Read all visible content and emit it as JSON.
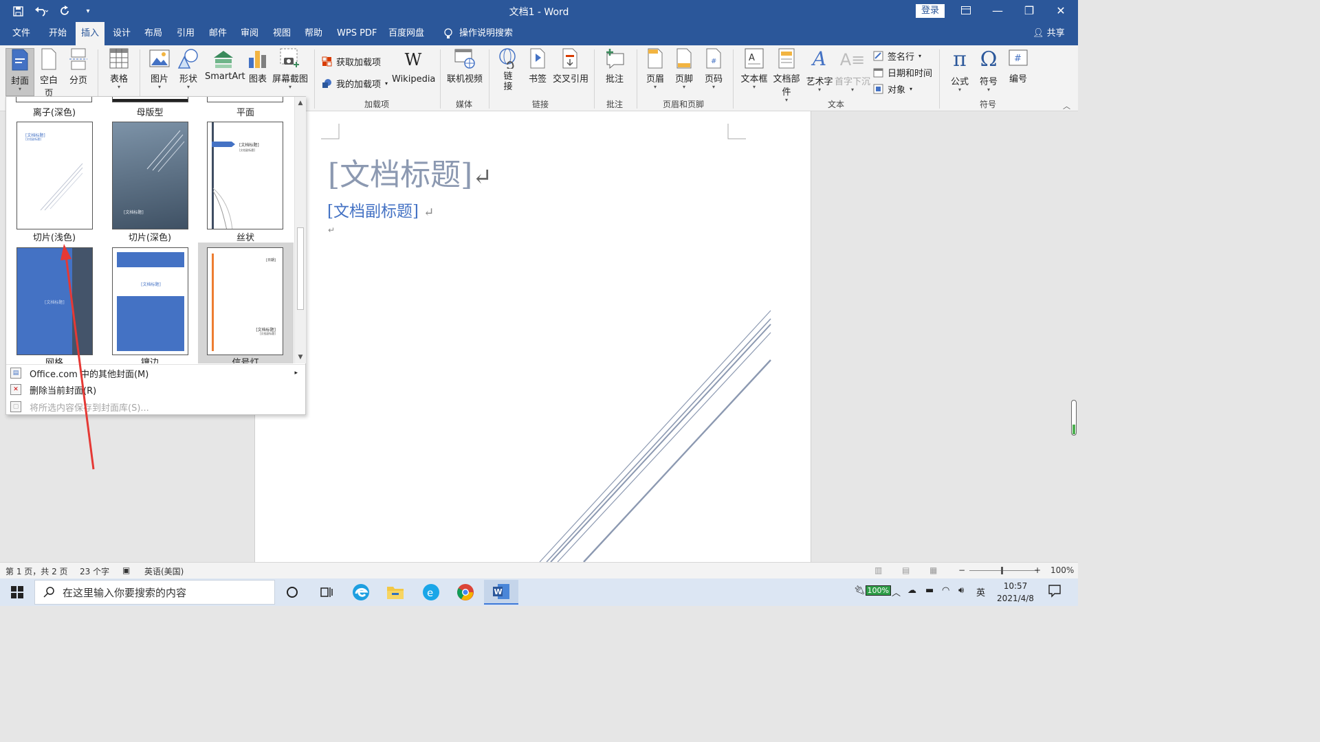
{
  "window": {
    "title": "文档1  -  Word",
    "login": "登录",
    "share": "共享"
  },
  "tabs": [
    "文件",
    "开始",
    "插入",
    "设计",
    "布局",
    "引用",
    "邮件",
    "审阅",
    "视图",
    "帮助",
    "WPS PDF",
    "百度网盘"
  ],
  "active_tab": "插入",
  "tell_me": "操作说明搜索",
  "ribbon": {
    "pages": {
      "cover": "封面",
      "blank": "空白页",
      "break": "分页"
    },
    "table": "表格",
    "illustrations": {
      "picture": "图片",
      "shapes": "形状",
      "smartart": "SmartArt",
      "chart": "图表",
      "screenshot": "屏幕截图"
    },
    "addins": {
      "get": "获取加载项",
      "mine": "我的加载项",
      "wikipedia": "Wikipedia",
      "group": "加载项"
    },
    "media": {
      "video": "联机视频",
      "group": "媒体"
    },
    "links": {
      "link": "链接",
      "bookmark": "书签",
      "crossref": "交叉引用",
      "group": "链接"
    },
    "comments": {
      "comment": "批注",
      "group": "批注"
    },
    "header_footer": {
      "header": "页眉",
      "footer": "页脚",
      "page_number": "页码",
      "group": "页眉和页脚"
    },
    "text": {
      "textbox": "文本框",
      "quickparts": "文档部件",
      "wordart": "艺术字",
      "dropcap": "首字下沉",
      "signature": "签名行",
      "datetime": "日期和时间",
      "object": "对象",
      "group": "文本"
    },
    "symbols": {
      "equation": "公式",
      "symbol": "符号",
      "number": "编号",
      "group": "符号"
    }
  },
  "gallery": {
    "top_labels": [
      "离子(深色)",
      "母版型",
      "平面"
    ],
    "covers": [
      {
        "label": "切片(浅色)",
        "title": "[文档标题]",
        "subtitle": "[文档副标题]"
      },
      {
        "label": "切片(深色)",
        "title": "[文档标题]"
      },
      {
        "label": "丝状",
        "title": "[文档标题]",
        "subtitle": "[文档副标题]"
      },
      {
        "label": "网格",
        "title": "[文档标题]"
      },
      {
        "label": "镶边",
        "title": "[文档标题]"
      },
      {
        "label": "信号灯",
        "title": "[文档标题]",
        "subtitle": "[文档副标题]",
        "date": "[日期]"
      }
    ],
    "menu": [
      {
        "label": "Office.com 中的其他封面(M)",
        "enabled": true
      },
      {
        "label": "删除当前封面(R)",
        "enabled": true
      },
      {
        "label": "将所选内容保存到封面库(S)...",
        "enabled": false
      }
    ]
  },
  "document": {
    "title": "[文档标题]",
    "subtitle": "[文档副标题]"
  },
  "status": {
    "page": "第 1 页，共 2 页",
    "words": "23 个字",
    "language": "英语(美国)",
    "zoom": "100%"
  },
  "taskbar": {
    "search_placeholder": "在这里输入你要搜索的内容",
    "battery": "100%",
    "ime": "英",
    "time": "10:57",
    "date": "2021/4/8"
  },
  "colors": {
    "word_blue": "#2b579a",
    "accent_blue": "#4472c4",
    "annotation_red": "#e53935"
  }
}
